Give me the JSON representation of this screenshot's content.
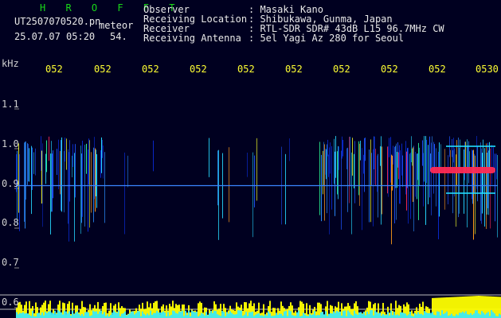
{
  "header": {
    "app_title": "H R O F F T",
    "file_name": "UT2507070520.pn",
    "mode_label": "meteor",
    "timestamp": "25.07.07 05:20",
    "count": "54.",
    "fields": [
      {
        "label": "Observer",
        "value": ": Masaki Kano"
      },
      {
        "label": "Receiving Location",
        "value": ": Shibukawa, Gunma, Japan"
      },
      {
        "label": "Receiver",
        "value": ": RTL-SDR SDR# 43dB L15 96.7MHz CW"
      },
      {
        "label": "Receiving Antenna",
        "value": ": 5el Yagi Az 280 for Seoul"
      }
    ]
  },
  "freq_axis": {
    "unit_label": "kHz",
    "ticks": [
      "1.1",
      "1.0",
      "0.9",
      "0.8",
      "0.7",
      "0.6"
    ],
    "range_khz": [
      0.6,
      1.15
    ]
  },
  "time_axis": {
    "labels": [
      "052",
      "052",
      "052",
      "052",
      "052",
      "052",
      "052",
      "052",
      "052",
      "0530"
    ],
    "start": "0520",
    "end": "0530"
  },
  "colors": {
    "background": "#000020",
    "text_white": "#e8e8e8",
    "title_green": "#19d919",
    "time_yellow": "#ffff33",
    "axis_cyan": "#22e0ff",
    "signal_red": "#ff2a55",
    "bar_yellow": "#ffff00",
    "bar_cyan": "#33eaff"
  },
  "spectrogram": {
    "carrier_khz": 0.895,
    "band_low_khz": 0.78,
    "band_high_khz": 1.02
  }
}
